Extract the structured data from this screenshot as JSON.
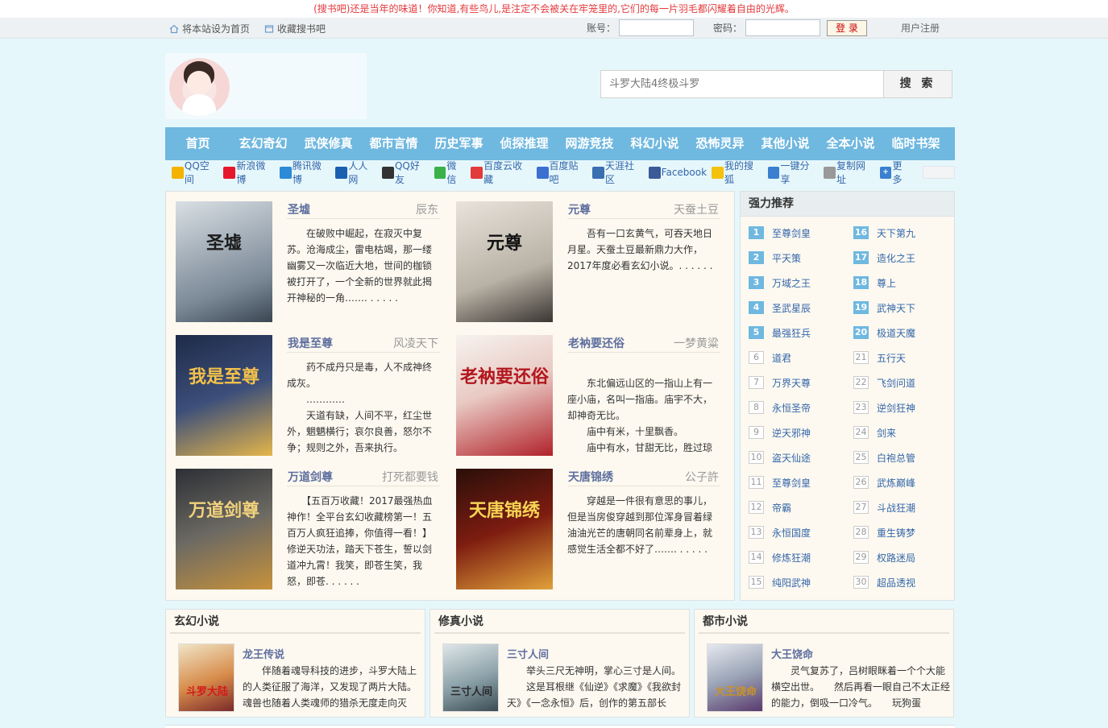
{
  "topnotice": "(搜书吧)还是当年的味道！你知道,有些鸟儿,是注定不会被关在牢笼里的,它们的每一片羽毛都闪耀着自由的光辉。",
  "topbar": {
    "set_home": "将本站设为首页",
    "bookmark": "收藏搜书吧",
    "account_label": "账号：",
    "password_label": "密码：",
    "login_button": "登 录",
    "register": "用户注册"
  },
  "search": {
    "placeholder": "斗罗大陆4终极斗罗",
    "button": "搜 索"
  },
  "nav": [
    "首页",
    "玄幻奇幻",
    "武侠修真",
    "都市言情",
    "历史军事",
    "侦探推理",
    "网游竞技",
    "科幻小说",
    "恐怖灵异",
    "其他小说",
    "全本小说",
    "临时书架"
  ],
  "share": [
    {
      "label": "QQ空间",
      "icon": "qzone-icon",
      "color": "#f5b301"
    },
    {
      "label": "新浪微博",
      "icon": "weibo-icon",
      "color": "#e6162d"
    },
    {
      "label": "腾讯微博",
      "icon": "tencent-weibo-icon",
      "color": "#2d8ad6"
    },
    {
      "label": "人人网",
      "icon": "renren-icon",
      "color": "#1b5fb0"
    },
    {
      "label": "QQ好友",
      "icon": "qq-icon",
      "color": "#333333"
    },
    {
      "label": "微信",
      "icon": "wechat-icon",
      "color": "#3bb149"
    },
    {
      "label": "百度云收藏",
      "icon": "heart-icon",
      "color": "#e33a3a"
    },
    {
      "label": "百度贴吧",
      "icon": "tieba-icon",
      "color": "#3b6fd1"
    },
    {
      "label": "天涯社区",
      "icon": "tianya-icon",
      "color": "#3a6fb0"
    },
    {
      "label": "Facebook",
      "icon": "facebook-icon",
      "color": "#3b5998"
    },
    {
      "label": "我的搜狐",
      "icon": "sohu-icon",
      "color": "#f4c20d"
    },
    {
      "label": "一键分享",
      "icon": "oneclick-share-icon",
      "color": "#3a7fd0"
    },
    {
      "label": "复制网址",
      "icon": "copy-link-icon",
      "color": "#999999"
    },
    {
      "label": "更多",
      "icon": "plus-icon",
      "color": "#3a7fd0"
    }
  ],
  "featured": [
    {
      "title": "圣墟",
      "author": "辰东",
      "desc": "　　在破败中崛起，在寂灭中复苏。沧海成尘，雷电枯竭，那一缕幽雾又一次临近大地，世间的枷锁被打开了，一个全新的世界就此揭开神秘的一角……. . . . . .",
      "cover_text": "圣墟"
    },
    {
      "title": "元尊",
      "author": "天蚕土豆",
      "desc": "　　吾有一口玄黄气，可吞天地日月星。天蚕土豆最新鼎力大作，2017年度必看玄幻小说。. . . . . .",
      "cover_text": "元尊"
    },
    {
      "title": "我是至尊",
      "author": "风凌天下",
      "desc": "　　药不成丹只是毒，人不成神终成灰。\n　　…………\n　　天道有缺，人间不平，红尘世外，魍魉横行；哀尔良善，怒尔不争；规则之外，吾来执行。",
      "cover_text": "我是至尊"
    },
    {
      "title": "老衲要还俗",
      "author": "一梦黄粱",
      "desc": "\n　　东北偏远山区的一指山上有一座小庙，名叫一指庙。庙宇不大，却神奇无比。\n　　庙中有米，十里飘香。\n　　庙中有水，甘甜无比，胜过琼",
      "cover_text": "老衲要还俗"
    },
    {
      "title": "万道剑尊",
      "author": "打死都要钱",
      "desc": "　　【五百万收藏！2017最强热血神作！全平台玄幻收藏榜第一！五百万人疯狂追捧，你值得一看！】修逆天功法，踏天下苍生，誓以剑道冲九霄！我笑，即苍生笑，我怒，即苍. . . . . .",
      "cover_text": "万道剑尊"
    },
    {
      "title": "天唐锦绣",
      "author": "公子許",
      "desc": "　　穿越是一件很有意思的事儿，但是当房俊穿越到那位浑身冒着绿油油光芒的唐朝同名前辈身上，就感觉生活全都不好了……. . . . . .",
      "cover_text": "天唐锦绣"
    }
  ],
  "sidebar": {
    "title": "强力推荐",
    "ranks": [
      {
        "n": "1",
        "name": "至尊剑皇"
      },
      {
        "n": "2",
        "name": "平天策"
      },
      {
        "n": "3",
        "name": "万域之王"
      },
      {
        "n": "4",
        "name": "圣武星辰"
      },
      {
        "n": "5",
        "name": "最强狂兵"
      },
      {
        "n": "6",
        "name": "道君"
      },
      {
        "n": "7",
        "name": "万界天尊"
      },
      {
        "n": "8",
        "name": "永恒圣帝"
      },
      {
        "n": "9",
        "name": "逆天邪神"
      },
      {
        "n": "10",
        "name": "盗天仙途"
      },
      {
        "n": "11",
        "name": "至尊剑皇"
      },
      {
        "n": "12",
        "name": "帝霸"
      },
      {
        "n": "13",
        "name": "永恒国度"
      },
      {
        "n": "14",
        "name": "修炼狂潮"
      },
      {
        "n": "15",
        "name": "纯阳武神"
      },
      {
        "n": "16",
        "name": "天下第九"
      },
      {
        "n": "17",
        "name": "造化之王"
      },
      {
        "n": "18",
        "name": "尊上"
      },
      {
        "n": "19",
        "name": "武神天下"
      },
      {
        "n": "20",
        "name": "极道天魔"
      },
      {
        "n": "21",
        "name": "五行天"
      },
      {
        "n": "22",
        "name": "飞剑问道"
      },
      {
        "n": "23",
        "name": "逆剑狂神"
      },
      {
        "n": "24",
        "name": "剑来"
      },
      {
        "n": "25",
        "name": "白袍总管"
      },
      {
        "n": "26",
        "name": "武炼巅峰"
      },
      {
        "n": "27",
        "name": "斗战狂潮"
      },
      {
        "n": "28",
        "name": "重生铸梦"
      },
      {
        "n": "29",
        "name": "权路迷局"
      },
      {
        "n": "30",
        "name": "超品透视"
      }
    ]
  },
  "categories": [
    {
      "heading": "玄幻小说",
      "title": "龙王传说",
      "desc": "　　伴随着魂导科技的进步，斗罗大陆上的人类征服了海洋，又发现了两片大陆。魂兽也随着人类魂师的猎杀无度走向灭",
      "cover_text": "斗罗大陆"
    },
    {
      "heading": "修真小说",
      "title": "三寸人间",
      "desc": "　　举头三尺无神明，掌心三寸是人间。\n　　这是耳根继《仙逆》《求魔》《我欲封天》《一念永恒》后，创作的第五部长",
      "cover_text": "三寸人间"
    },
    {
      "heading": "都市小说",
      "title": "大王饶命",
      "desc": "　　灵气复苏了，吕树眼眯着一个个大能横空出世。　　然后再看一眼自己不太正经的能力，倒吸一口冷气。　　玩狗蛋",
      "cover_text": "大王饶命"
    }
  ]
}
